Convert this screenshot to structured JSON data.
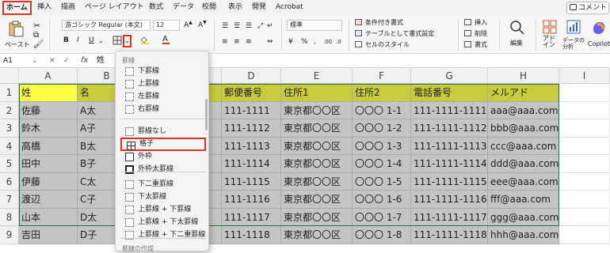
{
  "tabs": [
    "ホーム",
    "挿入",
    "描画",
    "ページ レイアウト",
    "数式",
    "データ",
    "校閲",
    "表示",
    "開発",
    "Acrobat"
  ],
  "comment_label": "コメント",
  "ribbon": {
    "paste": "ペースト",
    "font_name": "游ゴシック Regular (本文)",
    "font_size": "12",
    "bold": "B",
    "italic": "I",
    "underline": "U",
    "number_format": "標準",
    "cond_format": "条件付き書式",
    "table_format": "テーブルとして書式設定",
    "cell_style": "セルのスタイル",
    "insert": "挿入",
    "delete": "削除",
    "format": "書式",
    "edit": "編集",
    "addin": "アド\nイン",
    "analysis": "データの分析",
    "copilot": "Copilot"
  },
  "formula": {
    "cell_ref": "A1",
    "fx": "fx",
    "content": "姓"
  },
  "columns": [
    "A",
    "B",
    "C",
    "D",
    "E",
    "F",
    "G",
    "H",
    "I"
  ],
  "rows": [
    "1",
    "2",
    "3",
    "4",
    "5",
    "6",
    "7",
    "8",
    "9"
  ],
  "table": {
    "headers": [
      "姓",
      "名",
      "",
      "郵便番号",
      "住所1",
      "住所2",
      "電話番号",
      "メルアド"
    ],
    "rows": [
      [
        "佐藤",
        "A太",
        "",
        "111-1111",
        "東京都〇〇区",
        "〇〇〇 1-1",
        "111-1111-1111",
        "aaa@aaa.com"
      ],
      [
        "鈴木",
        "A子",
        "",
        "111-1112",
        "東京都〇〇区",
        "〇〇〇 1-2",
        "111-1111-1112",
        "bbb@aaa.com"
      ],
      [
        "高橋",
        "B太",
        "",
        "111-1113",
        "東京都〇〇区",
        "〇〇〇 1-3",
        "111-1111-1113",
        "ccc@aaa.com"
      ],
      [
        "田中",
        "B子",
        "",
        "111-1114",
        "東京都〇〇区",
        "〇〇〇 1-4",
        "111-1111-1114",
        "ddd@aaa.com"
      ],
      [
        "伊藤",
        "C太",
        "",
        "111-1115",
        "東京都〇〇区",
        "〇〇〇 1-5",
        "111-1111-1115",
        "eee@aaa.com"
      ],
      [
        "渡辺",
        "C子",
        "",
        "111-1116",
        "東京都〇〇区",
        "〇〇〇 1-6",
        "111-1111-1116",
        "fff@aaa.com"
      ],
      [
        "山本",
        "D太",
        "",
        "111-1117",
        "東京都〇〇区",
        "〇〇〇 1-7",
        "111-1111-1117",
        "ggg@aaa.com"
      ],
      [
        "吉田",
        "D子",
        "",
        "111-1118",
        "東京都〇〇区",
        "〇〇〇 1-8",
        "111-1111-1118",
        "hhh@aaa.com"
      ]
    ]
  },
  "menu": {
    "title": "罫線",
    "items": [
      "下罫線",
      "上罫線",
      "左罫線",
      "右罫線",
      "罫線なし",
      "格子",
      "外枠",
      "外枠太罫線",
      "下二重罫線",
      "下太罫線",
      "上罫線 + 下罫線",
      "上罫線 + 下太罫線",
      "上罫線 + 下二重罫線"
    ],
    "footer": "罫線の作成",
    "highlighted": "格子"
  },
  "colors": {
    "accent": "#217346",
    "highlight": "#e0311d",
    "header_fill": "#c9cb3c",
    "a1_fill": "#ffff44",
    "body_fill": "#c4c4c4"
  }
}
